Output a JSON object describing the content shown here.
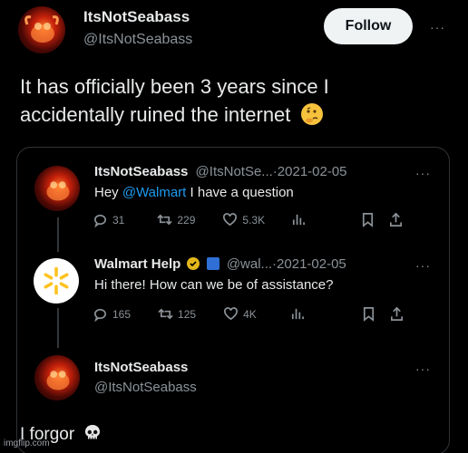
{
  "header": {
    "display_name": "ItsNotSeabass",
    "handle": "@ItsNotSeabass",
    "follow_label": "Follow",
    "more_label": "···"
  },
  "tweet": {
    "text": "It has officially been 3 years since I accidentally ruined the internet",
    "emoji_icon": "thinking-face-icon"
  },
  "quoted_thread": {
    "tweet1": {
      "display_name": "ItsNotSeabass",
      "handle_date": "@ItsNotSe...·2021-02-05",
      "text_before": "Hey ",
      "mention": "@Walmart",
      "text_after": " I have a question",
      "replies": "31",
      "retweets": "229",
      "likes": "5.3K"
    },
    "tweet2": {
      "display_name": "Walmart Help",
      "handle_date": "@wal...·2021-02-05",
      "text": "Hi there! How can we be of assistance?",
      "replies": "165",
      "retweets": "125",
      "likes": "4K"
    },
    "tweet3": {
      "display_name": "ItsNotSeabass",
      "handle": "@ItsNotSeabass"
    },
    "more_label": "···"
  },
  "reply": {
    "text": "I forgor",
    "emoji_icon": "skull-icon"
  },
  "watermark": "imgflip.com",
  "colors": {
    "background": "#000000",
    "text": "#e7e9ea",
    "muted": "#8b9298",
    "accent": "#1d9bf0",
    "follow_bg": "#eff3f4",
    "walmart_yellow": "#ffc220"
  }
}
